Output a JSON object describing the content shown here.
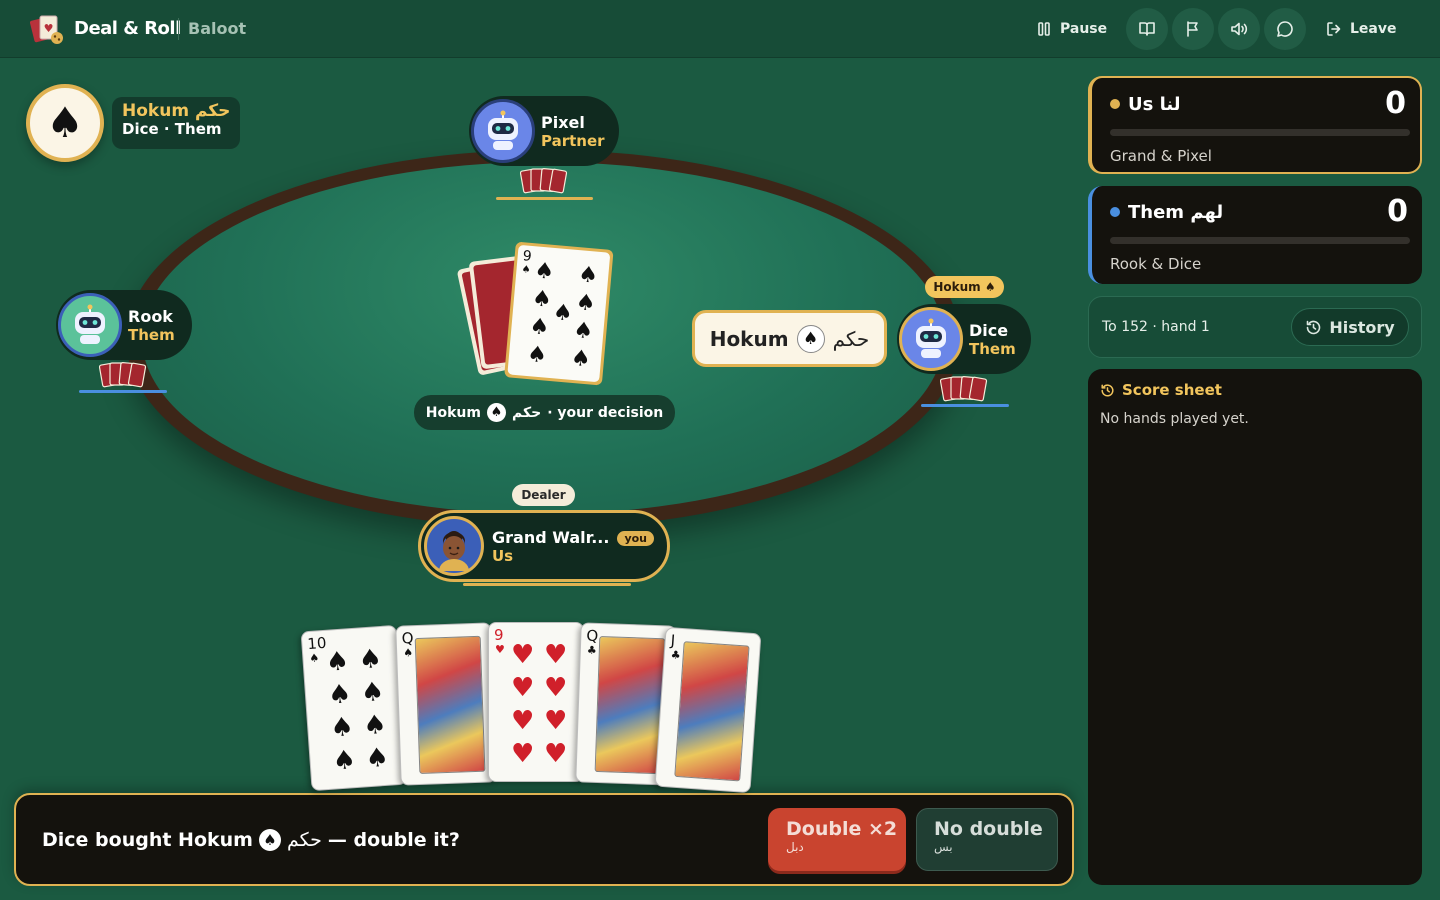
{
  "header": {
    "brand": "Deal & Roll",
    "game": "Baloot",
    "pause_label": "Pause",
    "leave_label": "Leave",
    "icons": [
      "pause-icon",
      "book-icon",
      "flag-icon",
      "sound-icon",
      "chat-icon",
      "logout-icon"
    ]
  },
  "contract": {
    "title": "Hokum حكم",
    "subtitle": "Dice · Them",
    "suit": "♠"
  },
  "seats": {
    "top": {
      "name": "Pixel",
      "team": "Partner"
    },
    "left": {
      "name": "Rook",
      "team": "Them"
    },
    "right": {
      "name": "Dice",
      "team": "Them",
      "tag": "Hokum ♠"
    },
    "bottom": {
      "name": "Grand Walr...",
      "you_tag": "you",
      "team": "Us",
      "dealer_tag": "Dealer"
    }
  },
  "center": {
    "upcard_rank": "9",
    "upcard_suit": "♠",
    "decision_word": "Hokum",
    "decision_arabic": "حكم",
    "decision_suffix": "· your decision",
    "bid_bubble_word": "Hokum",
    "bid_bubble_arabic": "حكم"
  },
  "hand": [
    {
      "rank": "10",
      "suit": "♠",
      "color": "#111111"
    },
    {
      "rank": "Q",
      "suit": "♠",
      "color": "#111111"
    },
    {
      "rank": "9",
      "suit": "♥",
      "color": "#d0202a"
    },
    {
      "rank": "Q",
      "suit": "♣",
      "color": "#111111"
    },
    {
      "rank": "J",
      "suit": "♣",
      "color": "#111111"
    }
  ],
  "prompt": {
    "before": "Dice bought Hokum",
    "arabic": "حكم",
    "after": "— double it?",
    "double_label": "Double ×2",
    "double_arabic": "دبل",
    "nodouble_label": "No double",
    "nodouble_arabic": "بس"
  },
  "scores": {
    "us": {
      "label": "Us لنا",
      "score": "0",
      "players": "Grand & Pixel",
      "color": "#e0b252"
    },
    "them": {
      "label": "Them لهم",
      "score": "0",
      "players": "Rook & Dice",
      "color": "#4a8fe0"
    }
  },
  "target": {
    "text": "To 152 · hand 1",
    "history_label": "History"
  },
  "score_sheet": {
    "title": "Score sheet",
    "empty": "No hands played yet."
  }
}
